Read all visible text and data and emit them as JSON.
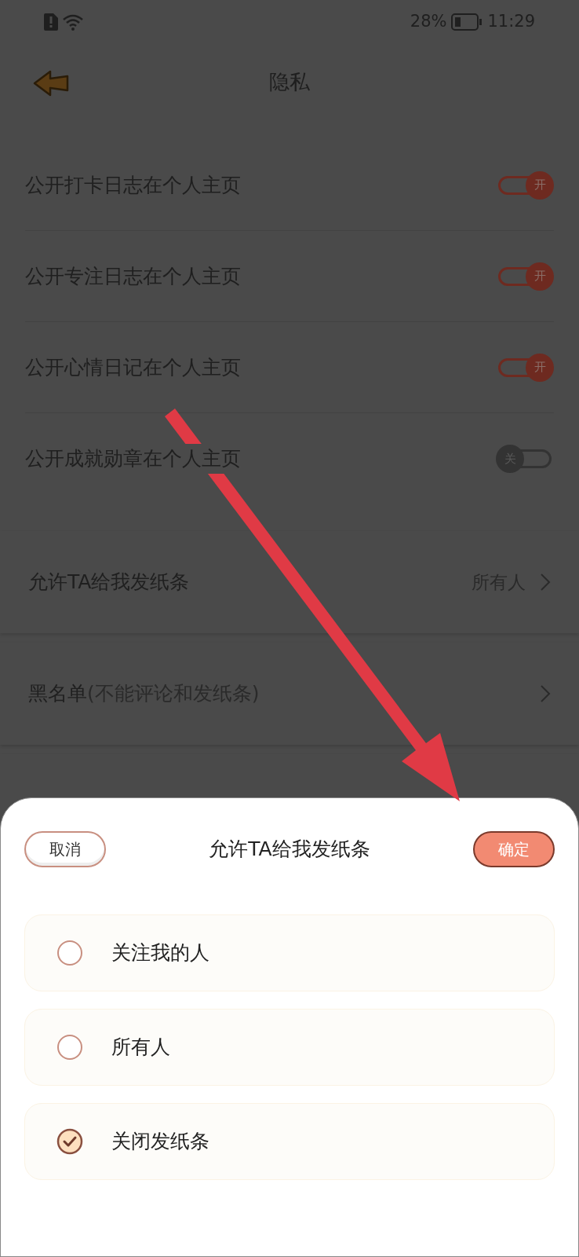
{
  "status_bar": {
    "battery_percent": "28%",
    "time": "11:29"
  },
  "header": {
    "title": "隐私"
  },
  "toggles": [
    {
      "label": "公开打卡日志在个人主页",
      "on": true,
      "knob_text": "开"
    },
    {
      "label": "公开专注日志在个人主页",
      "on": true,
      "knob_text": "开"
    },
    {
      "label": "公开心情日记在个人主页",
      "on": true,
      "knob_text": "开"
    },
    {
      "label": "公开成就勋章在个人主页",
      "on": false,
      "knob_text": "关"
    }
  ],
  "links": [
    {
      "label": "允许TA给我发纸条",
      "value": "所有人"
    },
    {
      "label": "黑名单",
      "note": "(不能评论和发纸条)"
    }
  ],
  "sheet": {
    "cancel": "取消",
    "title": "允许TA给我发纸条",
    "confirm": "确定",
    "options": [
      {
        "label": "关注我的人",
        "selected": false
      },
      {
        "label": "所有人",
        "selected": false
      },
      {
        "label": "关闭发纸条",
        "selected": true
      }
    ]
  }
}
